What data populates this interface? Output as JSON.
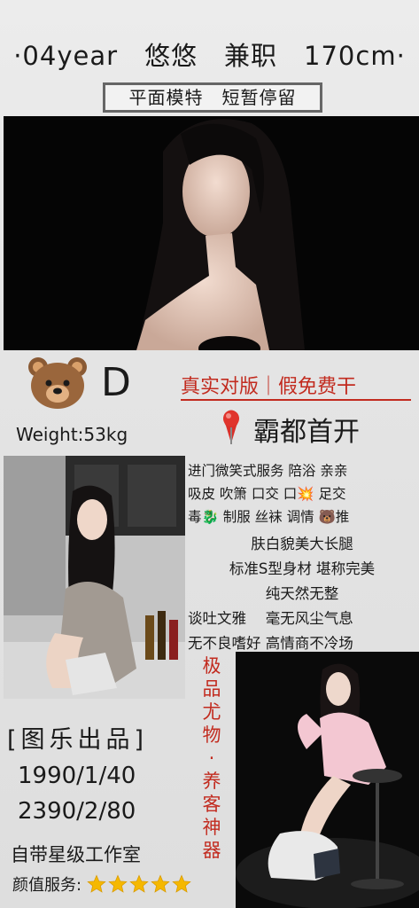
{
  "header": {
    "line": "·04year　悠悠　兼职　170cm·"
  },
  "subtitle": "平面模特　短暂停留",
  "profile": {
    "cup": "D",
    "weight": "Weight:53kg"
  },
  "slogan": "真实对版｜假免费干",
  "city": "霸都首开",
  "services": [
    "进门微笑式服务 陪浴 亲亲",
    "吸皮 吹箫 口交 口💥 足交",
    "毒🐉 制服 丝袜 调情 🐻推"
  ],
  "features": [
    "肤白貌美大长腿",
    "标准S型身材 堪称完美",
    "纯天然无整",
    "谈吐文雅　 毫无风尘气息",
    "无不良嗜好 高情商不冷场"
  ],
  "vertical_text": [
    "极",
    "品",
    "尤",
    "物",
    "·",
    "养",
    "客",
    "神",
    "器"
  ],
  "brand": "[图乐出品]",
  "prices": [
    "1990/1/40",
    "2390/2/80"
  ],
  "studio": "自带星级工作室",
  "rating": {
    "label": "颜值服务:",
    "stars": 5
  },
  "colors": {
    "accent_red": "#c22b1f",
    "star_gold": "#f5b800"
  }
}
